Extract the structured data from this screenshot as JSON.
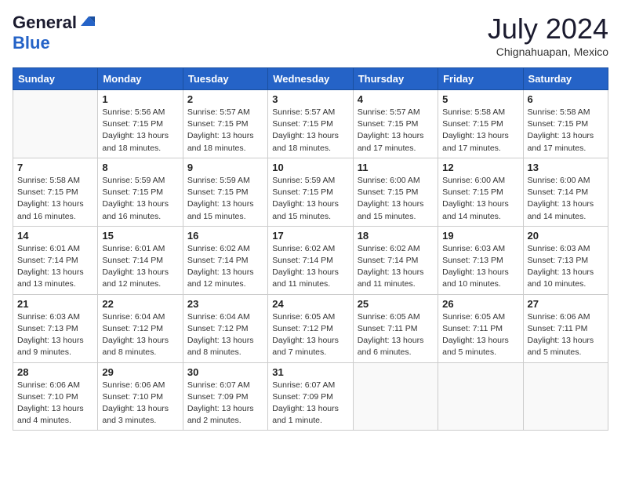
{
  "header": {
    "logo_general": "General",
    "logo_blue": "Blue",
    "month_title": "July 2024",
    "location": "Chignahuapan, Mexico"
  },
  "weekdays": [
    "Sunday",
    "Monday",
    "Tuesday",
    "Wednesday",
    "Thursday",
    "Friday",
    "Saturday"
  ],
  "weeks": [
    [
      {
        "day": "",
        "info": ""
      },
      {
        "day": "1",
        "info": "Sunrise: 5:56 AM\nSunset: 7:15 PM\nDaylight: 13 hours\nand 18 minutes."
      },
      {
        "day": "2",
        "info": "Sunrise: 5:57 AM\nSunset: 7:15 PM\nDaylight: 13 hours\nand 18 minutes."
      },
      {
        "day": "3",
        "info": "Sunrise: 5:57 AM\nSunset: 7:15 PM\nDaylight: 13 hours\nand 18 minutes."
      },
      {
        "day": "4",
        "info": "Sunrise: 5:57 AM\nSunset: 7:15 PM\nDaylight: 13 hours\nand 17 minutes."
      },
      {
        "day": "5",
        "info": "Sunrise: 5:58 AM\nSunset: 7:15 PM\nDaylight: 13 hours\nand 17 minutes."
      },
      {
        "day": "6",
        "info": "Sunrise: 5:58 AM\nSunset: 7:15 PM\nDaylight: 13 hours\nand 17 minutes."
      }
    ],
    [
      {
        "day": "7",
        "info": "Sunrise: 5:58 AM\nSunset: 7:15 PM\nDaylight: 13 hours\nand 16 minutes."
      },
      {
        "day": "8",
        "info": "Sunrise: 5:59 AM\nSunset: 7:15 PM\nDaylight: 13 hours\nand 16 minutes."
      },
      {
        "day": "9",
        "info": "Sunrise: 5:59 AM\nSunset: 7:15 PM\nDaylight: 13 hours\nand 15 minutes."
      },
      {
        "day": "10",
        "info": "Sunrise: 5:59 AM\nSunset: 7:15 PM\nDaylight: 13 hours\nand 15 minutes."
      },
      {
        "day": "11",
        "info": "Sunrise: 6:00 AM\nSunset: 7:15 PM\nDaylight: 13 hours\nand 15 minutes."
      },
      {
        "day": "12",
        "info": "Sunrise: 6:00 AM\nSunset: 7:15 PM\nDaylight: 13 hours\nand 14 minutes."
      },
      {
        "day": "13",
        "info": "Sunrise: 6:00 AM\nSunset: 7:14 PM\nDaylight: 13 hours\nand 14 minutes."
      }
    ],
    [
      {
        "day": "14",
        "info": "Sunrise: 6:01 AM\nSunset: 7:14 PM\nDaylight: 13 hours\nand 13 minutes."
      },
      {
        "day": "15",
        "info": "Sunrise: 6:01 AM\nSunset: 7:14 PM\nDaylight: 13 hours\nand 12 minutes."
      },
      {
        "day": "16",
        "info": "Sunrise: 6:02 AM\nSunset: 7:14 PM\nDaylight: 13 hours\nand 12 minutes."
      },
      {
        "day": "17",
        "info": "Sunrise: 6:02 AM\nSunset: 7:14 PM\nDaylight: 13 hours\nand 11 minutes."
      },
      {
        "day": "18",
        "info": "Sunrise: 6:02 AM\nSunset: 7:14 PM\nDaylight: 13 hours\nand 11 minutes."
      },
      {
        "day": "19",
        "info": "Sunrise: 6:03 AM\nSunset: 7:13 PM\nDaylight: 13 hours\nand 10 minutes."
      },
      {
        "day": "20",
        "info": "Sunrise: 6:03 AM\nSunset: 7:13 PM\nDaylight: 13 hours\nand 10 minutes."
      }
    ],
    [
      {
        "day": "21",
        "info": "Sunrise: 6:03 AM\nSunset: 7:13 PM\nDaylight: 13 hours\nand 9 minutes."
      },
      {
        "day": "22",
        "info": "Sunrise: 6:04 AM\nSunset: 7:12 PM\nDaylight: 13 hours\nand 8 minutes."
      },
      {
        "day": "23",
        "info": "Sunrise: 6:04 AM\nSunset: 7:12 PM\nDaylight: 13 hours\nand 8 minutes."
      },
      {
        "day": "24",
        "info": "Sunrise: 6:05 AM\nSunset: 7:12 PM\nDaylight: 13 hours\nand 7 minutes."
      },
      {
        "day": "25",
        "info": "Sunrise: 6:05 AM\nSunset: 7:11 PM\nDaylight: 13 hours\nand 6 minutes."
      },
      {
        "day": "26",
        "info": "Sunrise: 6:05 AM\nSunset: 7:11 PM\nDaylight: 13 hours\nand 5 minutes."
      },
      {
        "day": "27",
        "info": "Sunrise: 6:06 AM\nSunset: 7:11 PM\nDaylight: 13 hours\nand 5 minutes."
      }
    ],
    [
      {
        "day": "28",
        "info": "Sunrise: 6:06 AM\nSunset: 7:10 PM\nDaylight: 13 hours\nand 4 minutes."
      },
      {
        "day": "29",
        "info": "Sunrise: 6:06 AM\nSunset: 7:10 PM\nDaylight: 13 hours\nand 3 minutes."
      },
      {
        "day": "30",
        "info": "Sunrise: 6:07 AM\nSunset: 7:09 PM\nDaylight: 13 hours\nand 2 minutes."
      },
      {
        "day": "31",
        "info": "Sunrise: 6:07 AM\nSunset: 7:09 PM\nDaylight: 13 hours\nand 1 minute."
      },
      {
        "day": "",
        "info": ""
      },
      {
        "day": "",
        "info": ""
      },
      {
        "day": "",
        "info": ""
      }
    ]
  ]
}
